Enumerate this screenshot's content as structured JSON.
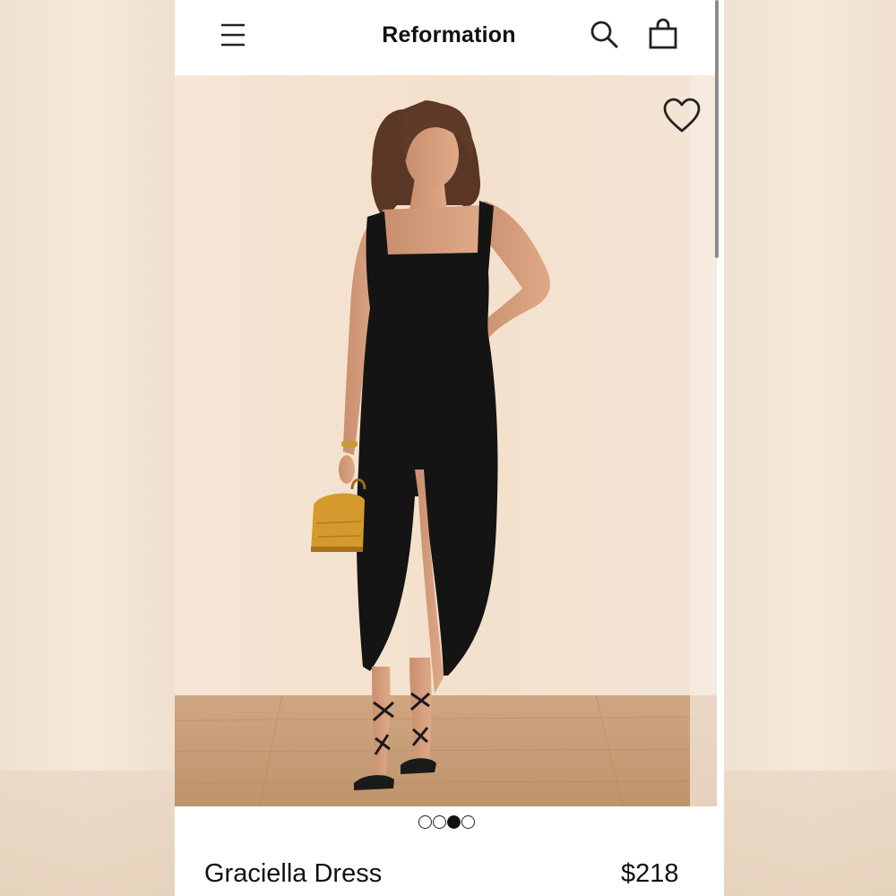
{
  "header": {
    "brand": "Reformation",
    "icons": {
      "menu": "hamburger-menu-icon",
      "search": "search-icon",
      "bag": "shopping-bag-icon"
    }
  },
  "gallery": {
    "favorite_icon": "heart-icon",
    "image_subject": "model wearing black midi dress with front slit, holding a mustard yellow handbag",
    "pagination": {
      "total": 4,
      "current": 3
    }
  },
  "product": {
    "name": "Graciella Dress",
    "price": "$218"
  },
  "colors": {
    "text": "#111111",
    "photo_wall": "#f4e3d3",
    "photo_floor": "#c8a07b",
    "dress": "#141414",
    "handbag": "#d49a2e"
  }
}
